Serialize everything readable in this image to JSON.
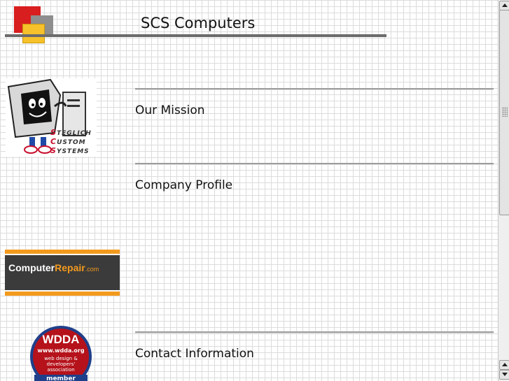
{
  "header": {
    "title": "SCS Computers"
  },
  "logos": {
    "scs": {
      "line1_initial": "S",
      "line1_rest": "TEGLICH",
      "line2_initial": "C",
      "line2_rest": "USTOM",
      "line3_initial": "S",
      "line3_rest": "YSTEMS"
    },
    "computer_repair": {
      "part1": "Computer",
      "part2": "Repair",
      "part3": ".com"
    },
    "wdda": {
      "acronym": "WDDA",
      "url": "www.wdda.org",
      "line1": "web design &",
      "line2": "developers'",
      "line3": "association",
      "badge": "member"
    }
  },
  "sections": [
    {
      "title": "Our Mission"
    },
    {
      "title": "Company Profile"
    },
    {
      "title": "Contact Information"
    }
  ],
  "scrollbar": {
    "position_fraction": 0.0
  }
}
